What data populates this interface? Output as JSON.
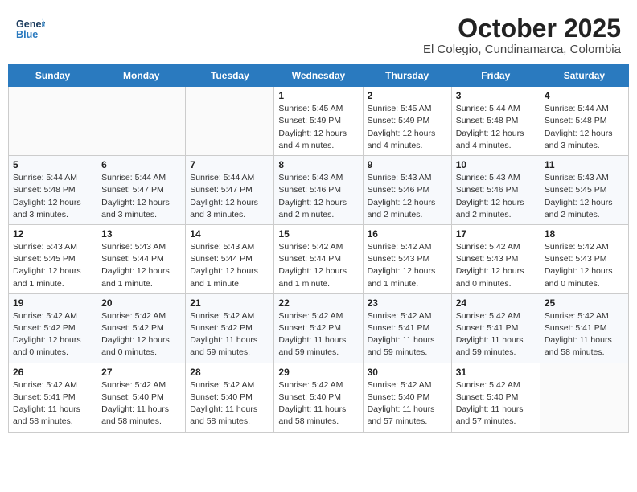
{
  "header": {
    "logo_general": "General",
    "logo_blue": "Blue",
    "title": "October 2025",
    "subtitle": "El Colegio, Cundinamarca, Colombia"
  },
  "weekdays": [
    "Sunday",
    "Monday",
    "Tuesday",
    "Wednesday",
    "Thursday",
    "Friday",
    "Saturday"
  ],
  "weeks": [
    [
      {
        "day": "",
        "info": ""
      },
      {
        "day": "",
        "info": ""
      },
      {
        "day": "",
        "info": ""
      },
      {
        "day": "1",
        "info": "Sunrise: 5:45 AM\nSunset: 5:49 PM\nDaylight: 12 hours\nand 4 minutes."
      },
      {
        "day": "2",
        "info": "Sunrise: 5:45 AM\nSunset: 5:49 PM\nDaylight: 12 hours\nand 4 minutes."
      },
      {
        "day": "3",
        "info": "Sunrise: 5:44 AM\nSunset: 5:48 PM\nDaylight: 12 hours\nand 4 minutes."
      },
      {
        "day": "4",
        "info": "Sunrise: 5:44 AM\nSunset: 5:48 PM\nDaylight: 12 hours\nand 3 minutes."
      }
    ],
    [
      {
        "day": "5",
        "info": "Sunrise: 5:44 AM\nSunset: 5:48 PM\nDaylight: 12 hours\nand 3 minutes."
      },
      {
        "day": "6",
        "info": "Sunrise: 5:44 AM\nSunset: 5:47 PM\nDaylight: 12 hours\nand 3 minutes."
      },
      {
        "day": "7",
        "info": "Sunrise: 5:44 AM\nSunset: 5:47 PM\nDaylight: 12 hours\nand 3 minutes."
      },
      {
        "day": "8",
        "info": "Sunrise: 5:43 AM\nSunset: 5:46 PM\nDaylight: 12 hours\nand 2 minutes."
      },
      {
        "day": "9",
        "info": "Sunrise: 5:43 AM\nSunset: 5:46 PM\nDaylight: 12 hours\nand 2 minutes."
      },
      {
        "day": "10",
        "info": "Sunrise: 5:43 AM\nSunset: 5:46 PM\nDaylight: 12 hours\nand 2 minutes."
      },
      {
        "day": "11",
        "info": "Sunrise: 5:43 AM\nSunset: 5:45 PM\nDaylight: 12 hours\nand 2 minutes."
      }
    ],
    [
      {
        "day": "12",
        "info": "Sunrise: 5:43 AM\nSunset: 5:45 PM\nDaylight: 12 hours\nand 1 minute."
      },
      {
        "day": "13",
        "info": "Sunrise: 5:43 AM\nSunset: 5:44 PM\nDaylight: 12 hours\nand 1 minute."
      },
      {
        "day": "14",
        "info": "Sunrise: 5:43 AM\nSunset: 5:44 PM\nDaylight: 12 hours\nand 1 minute."
      },
      {
        "day": "15",
        "info": "Sunrise: 5:42 AM\nSunset: 5:44 PM\nDaylight: 12 hours\nand 1 minute."
      },
      {
        "day": "16",
        "info": "Sunrise: 5:42 AM\nSunset: 5:43 PM\nDaylight: 12 hours\nand 1 minute."
      },
      {
        "day": "17",
        "info": "Sunrise: 5:42 AM\nSunset: 5:43 PM\nDaylight: 12 hours\nand 0 minutes."
      },
      {
        "day": "18",
        "info": "Sunrise: 5:42 AM\nSunset: 5:43 PM\nDaylight: 12 hours\nand 0 minutes."
      }
    ],
    [
      {
        "day": "19",
        "info": "Sunrise: 5:42 AM\nSunset: 5:42 PM\nDaylight: 12 hours\nand 0 minutes."
      },
      {
        "day": "20",
        "info": "Sunrise: 5:42 AM\nSunset: 5:42 PM\nDaylight: 12 hours\nand 0 minutes."
      },
      {
        "day": "21",
        "info": "Sunrise: 5:42 AM\nSunset: 5:42 PM\nDaylight: 11 hours\nand 59 minutes."
      },
      {
        "day": "22",
        "info": "Sunrise: 5:42 AM\nSunset: 5:42 PM\nDaylight: 11 hours\nand 59 minutes."
      },
      {
        "day": "23",
        "info": "Sunrise: 5:42 AM\nSunset: 5:41 PM\nDaylight: 11 hours\nand 59 minutes."
      },
      {
        "day": "24",
        "info": "Sunrise: 5:42 AM\nSunset: 5:41 PM\nDaylight: 11 hours\nand 59 minutes."
      },
      {
        "day": "25",
        "info": "Sunrise: 5:42 AM\nSunset: 5:41 PM\nDaylight: 11 hours\nand 58 minutes."
      }
    ],
    [
      {
        "day": "26",
        "info": "Sunrise: 5:42 AM\nSunset: 5:41 PM\nDaylight: 11 hours\nand 58 minutes."
      },
      {
        "day": "27",
        "info": "Sunrise: 5:42 AM\nSunset: 5:40 PM\nDaylight: 11 hours\nand 58 minutes."
      },
      {
        "day": "28",
        "info": "Sunrise: 5:42 AM\nSunset: 5:40 PM\nDaylight: 11 hours\nand 58 minutes."
      },
      {
        "day": "29",
        "info": "Sunrise: 5:42 AM\nSunset: 5:40 PM\nDaylight: 11 hours\nand 58 minutes."
      },
      {
        "day": "30",
        "info": "Sunrise: 5:42 AM\nSunset: 5:40 PM\nDaylight: 11 hours\nand 57 minutes."
      },
      {
        "day": "31",
        "info": "Sunrise: 5:42 AM\nSunset: 5:40 PM\nDaylight: 11 hours\nand 57 minutes."
      },
      {
        "day": "",
        "info": ""
      }
    ]
  ]
}
